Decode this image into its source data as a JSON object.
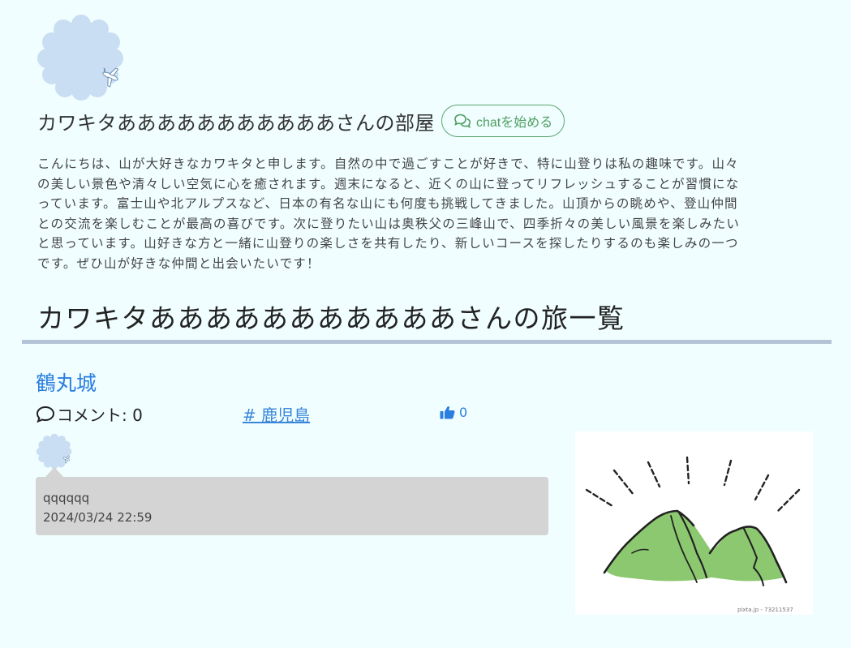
{
  "profile": {
    "title": "カワキタあああああああああああさんの部屋",
    "chat_button_label": "chatを始める",
    "intro": "こんにちは、山が大好きなカワキタと申します。自然の中で過ごすことが好きで、特に山登りは私の趣味です。山々の美しい景色や清々しい空気に心を癒されます。週末になると、近くの山に登ってリフレッシュすることが習慣になっています。富士山や北アルプスなど、日本の有名な山にも何度も挑戦してきました。山頂からの眺めや、登山仲間との交流を楽しむことが最高の喜びです。次に登りたい山は奥秩父の三峰山で、四季折々の美しい風景を楽しみたいと思っています。山好きな方と一緒に山登りの楽しさを共有したり、新しいコースを探したりするのも楽しみの一つです。ぜひ山が好きな仲間と出会いたいです！"
  },
  "trips_section": {
    "title": "カワキタあああああああああああさんの旅一覧"
  },
  "trip": {
    "title": "鶴丸城",
    "comment_label": "コメント: 0",
    "tag": "# 鹿児島",
    "like_count": "0",
    "comment": {
      "text": "qqqqqq",
      "date": "2024/03/24 22:59"
    },
    "image_caption": "pixta.jp - 73211537"
  },
  "colors": {
    "background": "#f0feff",
    "link": "#2a7ee0",
    "chat_green": "#4f9e62",
    "divider": "#b4c4d6",
    "comment_bg": "#d4d4d4",
    "mountain_green": "#8cc870"
  },
  "icons": {
    "chat": "chat-bubbles-icon",
    "comment": "speech-bubble-icon",
    "like": "thumbs-up-icon",
    "avatar": "cloud-plane-avatar"
  }
}
